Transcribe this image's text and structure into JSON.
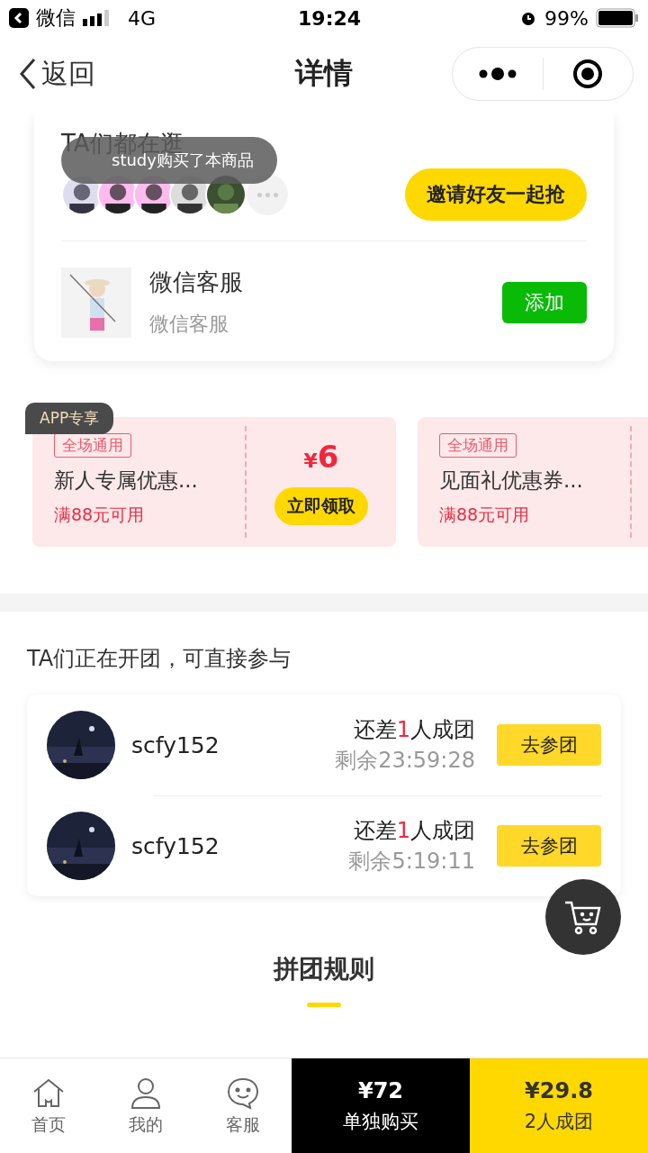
{
  "status_bar": {
    "back_app": "微信",
    "network": "4G",
    "time": "19:24",
    "battery": "99%"
  },
  "nav": {
    "back": "返回",
    "title": "详情"
  },
  "browsing": {
    "title": "TA们都在逛",
    "toast": "study购买了本商品",
    "invite": "邀请好友一起抢",
    "contact": {
      "name": "微信客服",
      "subtitle": "微信客服",
      "add": "添加"
    }
  },
  "coupons": {
    "badge": "APP专享",
    "items": [
      {
        "tag": "全场通用",
        "name": "新人专属优惠...",
        "condition": "满88元可用",
        "amount": "6",
        "currency": "¥",
        "claim": "立即领取"
      },
      {
        "tag": "全场通用",
        "name": "见面礼优惠券...",
        "condition": "满88元可用"
      }
    ]
  },
  "groups": {
    "title": "TA们正在开团，可直接参与",
    "rows": [
      {
        "user": "scfy152",
        "status": "还差**1**人成团",
        "remaining": "剩余23:59:28",
        "join": "去参团"
      },
      {
        "user": "scfy152",
        "status": "还差**1**人成团",
        "remaining": "剩余5:19:11",
        "join": "去参团"
      }
    ]
  },
  "rules": {
    "title": "拼团规则"
  },
  "tab_bar": [
    {
      "kind": "home",
      "label": "首页"
    },
    {
      "kind": "user",
      "label": "我的"
    },
    {
      "kind": "chat",
      "label": "客服"
    }
  ],
  "buy": [
    {
      "kind": "single",
      "price": "¥72",
      "label": "单独购买"
    },
    {
      "kind": "group",
      "price": "¥29.8",
      "label": "2人成团"
    }
  ]
}
